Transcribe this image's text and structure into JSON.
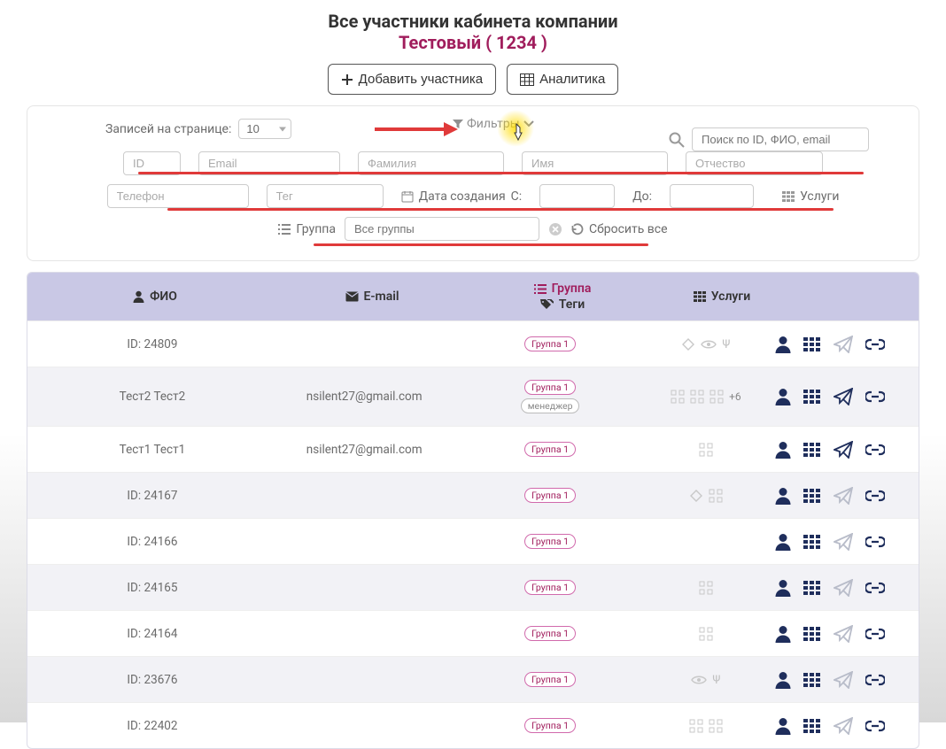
{
  "header": {
    "title": "Все участники кабинета компании",
    "subtitle": "Тестовый ( 1234 )"
  },
  "buttons": {
    "add_participant": "Добавить участника",
    "analytics": "Аналитика"
  },
  "filters": {
    "records_label": "Записей на странице:",
    "records_value": "10",
    "toggle_label": "Фильтры",
    "search_placeholder": "Поиск по ID, ФИО, email",
    "id_ph": "ID",
    "email_ph": "Email",
    "lname_ph": "Фамилия",
    "fname_ph": "Имя",
    "mname_ph": "Отчество",
    "phone_ph": "Телефон",
    "tag_ph": "Тег",
    "date_created_label": "Дата создания",
    "date_from_label": "С:",
    "date_to_label": "До:",
    "services_label": "Услуги",
    "group_label": "Группа",
    "group_value": "Все группы",
    "reset_all": "Сбросить все"
  },
  "table": {
    "headers": {
      "fio": "ФИО",
      "email": "E-mail",
      "group": "Группа",
      "tags": "Теги",
      "services": "Услуги"
    },
    "rows": [
      {
        "fio": "ID: 24809",
        "email": "",
        "group_badge": "Группа 1",
        "tag_badge": "",
        "svc_icons": [
          "diamond",
          "eye",
          "psi"
        ],
        "svc_more": "",
        "send_active": false
      },
      {
        "fio": "Тест2 Тест2",
        "email": "nsilent27@gmail.com",
        "group_badge": "Группа 1",
        "tag_badge": "менеджер",
        "svc_icons": [
          "qr",
          "qr",
          "qr"
        ],
        "svc_more": "+6",
        "send_active": true
      },
      {
        "fio": "Тест1 Тест1",
        "email": "nsilent27@gmail.com",
        "group_badge": "Группа 1",
        "tag_badge": "",
        "svc_icons": [
          "qr"
        ],
        "svc_more": "",
        "send_active": true
      },
      {
        "fio": "ID: 24167",
        "email": "",
        "group_badge": "Группа 1",
        "tag_badge": "",
        "svc_icons": [
          "diamond",
          "qr"
        ],
        "svc_more": "",
        "send_active": false
      },
      {
        "fio": "ID: 24166",
        "email": "",
        "group_badge": "Группа 1",
        "tag_badge": "",
        "svc_icons": [],
        "svc_more": "",
        "send_active": false
      },
      {
        "fio": "ID: 24165",
        "email": "",
        "group_badge": "Группа 1",
        "tag_badge": "",
        "svc_icons": [
          "qr"
        ],
        "svc_more": "",
        "send_active": false
      },
      {
        "fio": "ID: 24164",
        "email": "",
        "group_badge": "Группа 1",
        "tag_badge": "",
        "svc_icons": [
          "qr"
        ],
        "svc_more": "",
        "send_active": false
      },
      {
        "fio": "ID: 23676",
        "email": "",
        "group_badge": "Группа 1",
        "tag_badge": "",
        "svc_icons": [
          "eye",
          "psi"
        ],
        "svc_more": "",
        "send_active": false
      },
      {
        "fio": "ID: 22402",
        "email": "",
        "group_badge": "Группа 1",
        "tag_badge": "",
        "svc_icons": [
          "qr",
          "qr"
        ],
        "svc_more": "",
        "send_active": false
      }
    ]
  }
}
